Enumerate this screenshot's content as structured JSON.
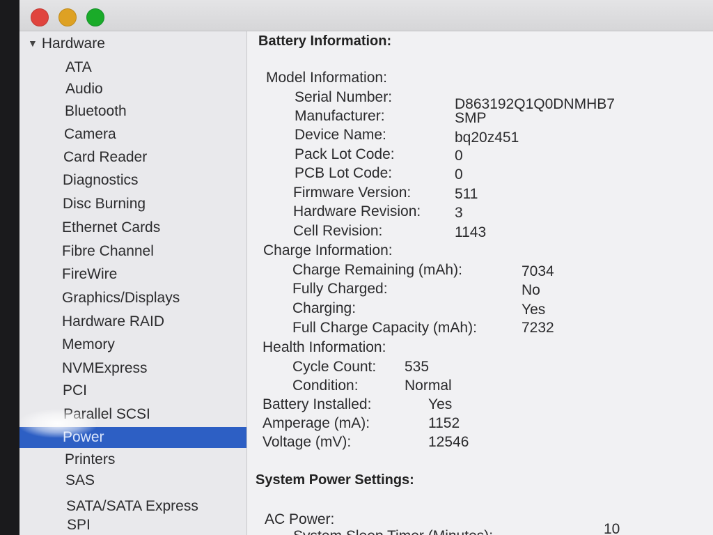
{
  "sidebar": {
    "header": "Hardware",
    "items": [
      {
        "label": "ATA"
      },
      {
        "label": "Audio"
      },
      {
        "label": "Bluetooth"
      },
      {
        "label": "Camera"
      },
      {
        "label": "Card Reader"
      },
      {
        "label": "Diagnostics"
      },
      {
        "label": "Disc Burning"
      },
      {
        "label": "Ethernet Cards"
      },
      {
        "label": "Fibre Channel"
      },
      {
        "label": "FireWire"
      },
      {
        "label": "Graphics/Displays"
      },
      {
        "label": "Hardware RAID"
      },
      {
        "label": "Memory"
      },
      {
        "label": "NVMExpress"
      },
      {
        "label": "PCI"
      },
      {
        "label": "Parallel SCSI"
      },
      {
        "label": "Power",
        "selected": true
      },
      {
        "label": "Printers"
      },
      {
        "label": "SAS"
      },
      {
        "label": "SATA/SATA Express"
      },
      {
        "label": "SPI"
      }
    ]
  },
  "battery": {
    "title": "Battery Information:",
    "model": {
      "label": "Model Information:",
      "serial_label": "Serial Number:",
      "serial_value": "D863192Q1Q0DNMHB7",
      "manufacturer_label": "Manufacturer:",
      "manufacturer_value": "SMP",
      "device_label": "Device Name:",
      "device_value": "bq20z451",
      "pack_lot_label": "Pack Lot Code:",
      "pack_lot_value": "0",
      "pcb_lot_label": "PCB Lot Code:",
      "pcb_lot_value": "0",
      "firmware_label": "Firmware Version:",
      "firmware_value": "511",
      "hardware_rev_label": "Hardware Revision:",
      "hardware_rev_value": "3",
      "cell_rev_label": "Cell Revision:",
      "cell_rev_value": "1143"
    },
    "charge": {
      "label": "Charge Information:",
      "remaining_label": "Charge Remaining (mAh):",
      "remaining_value": "7034",
      "fully_charged_label": "Fully Charged:",
      "fully_charged_value": "No",
      "charging_label": "Charging:",
      "charging_value": "Yes",
      "full_capacity_label": "Full Charge Capacity (mAh):",
      "full_capacity_value": "7232"
    },
    "health": {
      "label": "Health Information:",
      "cycle_label": "Cycle Count:",
      "cycle_value": "535",
      "condition_label": "Condition:",
      "condition_value": "Normal"
    },
    "installed_label": "Battery Installed:",
    "installed_value": "Yes",
    "amperage_label": "Amperage (mA):",
    "amperage_value": "1152",
    "voltage_label": "Voltage (mV):",
    "voltage_value": "12546"
  },
  "power_settings": {
    "title": "System Power Settings:",
    "ac_power_label": "AC Power:",
    "sleep_timer_label": "System Sleep Timer (Minutes):",
    "sleep_timer_value": "10"
  },
  "colors": {
    "selection": "#2d5fc4",
    "sidebar_bg": "#e9e9ec",
    "content_bg": "#f1f1f3",
    "close_button": "#e0443e",
    "minimize_button": "#dea123",
    "zoom_button": "#1aab29"
  }
}
